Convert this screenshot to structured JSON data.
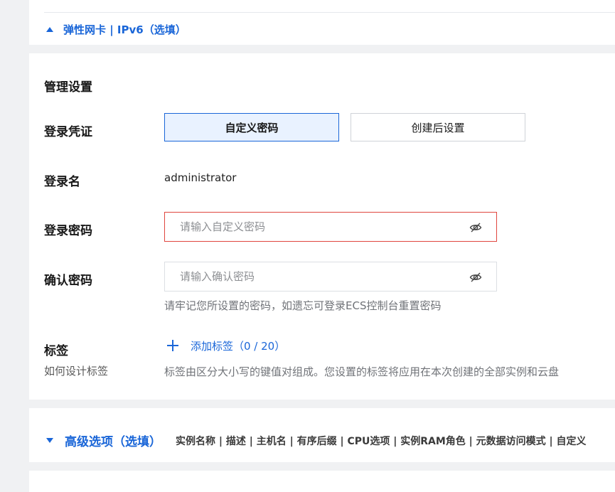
{
  "network_toggle": {
    "label": "弹性网卡 | IPv6（选填）"
  },
  "management": {
    "section_title": "管理设置",
    "login_credential": {
      "label": "登录凭证",
      "options": [
        "自定义密码",
        "创建后设置"
      ],
      "selected": "自定义密码"
    },
    "login_name": {
      "label": "登录名",
      "value": "administrator"
    },
    "login_password": {
      "label": "登录密码",
      "placeholder": "请输入自定义密码",
      "value": ""
    },
    "confirm_password": {
      "label": "确认密码",
      "placeholder": "请输入确认密码",
      "value": ""
    },
    "password_hint": "请牢记您所设置的密码，如遗忘可登录ECS控制台重置密码",
    "tags": {
      "label": "标签",
      "help_link": "如何设计标签",
      "add_label": "添加标签（0 / 20）",
      "hint": "标签由区分大小写的键值对组成。您设置的标签将应用在本次创建的全部实例和云盘"
    }
  },
  "advanced": {
    "title": "高级选项（选填）",
    "description": "实例名称 | 描述 | 主机名 | 有序后缀 | CPU选项 | 实例RAM角色 | 元数据访问模式 | 自定义"
  },
  "colors": {
    "accent": "#1a66d8",
    "error": "#e0463e",
    "selected_bg": "#e9f2ff",
    "page_bg": "#f0f1f3"
  },
  "icons": {
    "password_visibility": "eye-off-icon",
    "collapse": "triangle-up-icon",
    "expand": "triangle-down-icon",
    "add": "plus-icon"
  }
}
